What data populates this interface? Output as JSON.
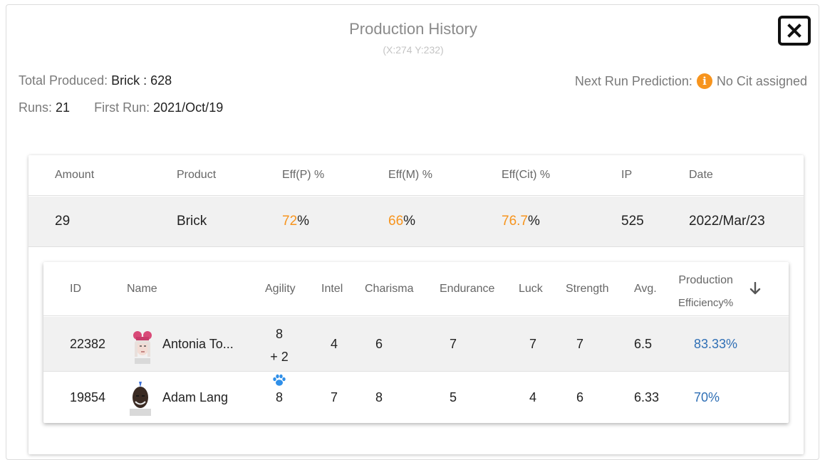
{
  "dialog": {
    "title": "Production History",
    "coords": "(X:274 Y:232)"
  },
  "summary": {
    "total_label": "Total Produced:",
    "total_value": "Brick : 628",
    "runs_label": "Runs:",
    "runs_value": "21",
    "first_run_label": "First Run:",
    "first_run_value": "2021/Oct/19",
    "prediction_label": "Next Run Prediction:",
    "prediction_value": "No Cit assigned"
  },
  "run_table": {
    "headers": [
      "Amount",
      "Product",
      "Eff(P) %",
      "Eff(M) %",
      "Eff(Cit) %",
      "IP",
      "Date"
    ],
    "row": {
      "amount": "29",
      "product": "Brick",
      "eff_p": "72",
      "eff_m": "66",
      "eff_cit": "76.7",
      "pct": "%",
      "ip": "525",
      "date": "2022/Mar/23"
    }
  },
  "citizen_table": {
    "headers": {
      "id": "ID",
      "name": "Name",
      "agility": "Agility",
      "intel": "Intel",
      "charisma": "Charisma",
      "endurance": "Endurance",
      "luck": "Luck",
      "strength": "Strength",
      "avg": "Avg.",
      "production": "Production",
      "efficiency": "Efficiency%"
    },
    "rows": [
      {
        "id": "22382",
        "name": "Antonia To...",
        "agility": "8",
        "agility_bonus": "+ 2",
        "intel": "4",
        "charisma": "6",
        "endurance": "7",
        "luck": "7",
        "strength": "7",
        "avg": "6.5",
        "efficiency": "83.33%"
      },
      {
        "id": "19854",
        "name": "Adam Lang",
        "agility": "8",
        "intel": "7",
        "charisma": "8",
        "endurance": "5",
        "luck": "4",
        "strength": "6",
        "avg": "6.33",
        "efficiency": "70%"
      }
    ]
  },
  "icons": {
    "close": "close-icon",
    "info": "info-icon",
    "sort": "arrow-down-icon",
    "paw": "paw-icon"
  },
  "colors": {
    "accent_orange": "#f7941d",
    "efficiency_blue": "#2f6fb5",
    "paw_blue": "#2f8fe8"
  }
}
